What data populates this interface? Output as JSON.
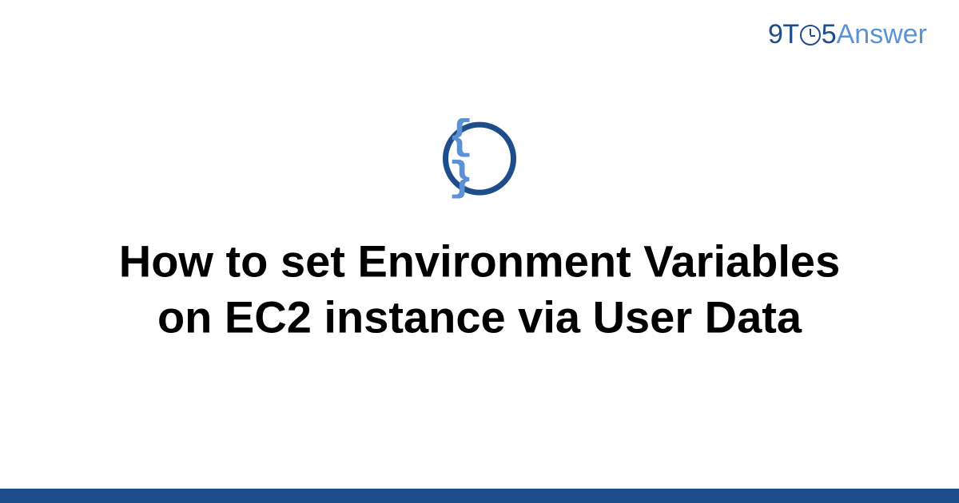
{
  "logo": {
    "part1": "9T",
    "part2": "5",
    "part3": "Answer"
  },
  "icon": {
    "braces": "{ }"
  },
  "title": "How to set Environment Variables on EC2 instance via User Data",
  "colors": {
    "primary": "#1e4d8b",
    "accent": "#5b92d4",
    "text": "#000000",
    "background": "#ffffff"
  }
}
